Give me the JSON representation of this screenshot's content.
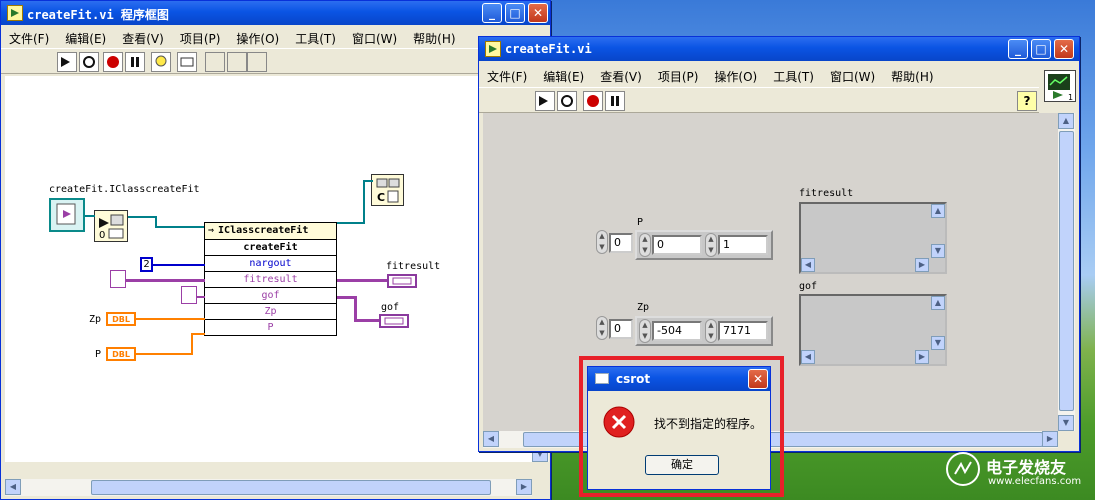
{
  "block_diagram_window": {
    "title": "createFit.vi 程序框图",
    "menu": [
      "文件(F)",
      "编辑(E)",
      "查看(V)",
      "项目(P)",
      "操作(O)",
      "工具(T)",
      "窗口(W)",
      "帮助(H)"
    ],
    "diagram": {
      "constructor_label": "createFit.IClasscreateFit",
      "invoke_node_class": "IClasscreateFit",
      "invoke_method": "createFit",
      "rows": [
        "nargout",
        "fitresult",
        "gof",
        "Zp",
        "P"
      ],
      "nargout_value": "2",
      "terminal_zp": "Zp",
      "terminal_p": "P",
      "dbl_label": "DBL",
      "indicator_fitresult": "fitresult",
      "indicator_gof": "gof"
    }
  },
  "front_panel_window": {
    "title": "createFit.vi",
    "menu": [
      "文件(F)",
      "编辑(E)",
      "查看(V)",
      "项目(P)",
      "操作(O)",
      "工具(T)",
      "窗口(W)",
      "帮助(H)"
    ],
    "help_button": "?",
    "controls": {
      "p_label": "P",
      "p_index": "0",
      "p_values": [
        "0",
        "1"
      ],
      "zp_label": "Zp",
      "zp_index": "0",
      "zp_values": [
        "-504",
        "7171"
      ],
      "fitresult_label": "fitresult",
      "gof_label": "gof"
    }
  },
  "error_dialog": {
    "title": "csrot",
    "message": "找不到指定的程序。",
    "ok_button": "确定",
    "highlight_color": "#e8202a"
  },
  "watermark": {
    "brand": "电子发烧友",
    "url": "www.elecfans.com"
  }
}
